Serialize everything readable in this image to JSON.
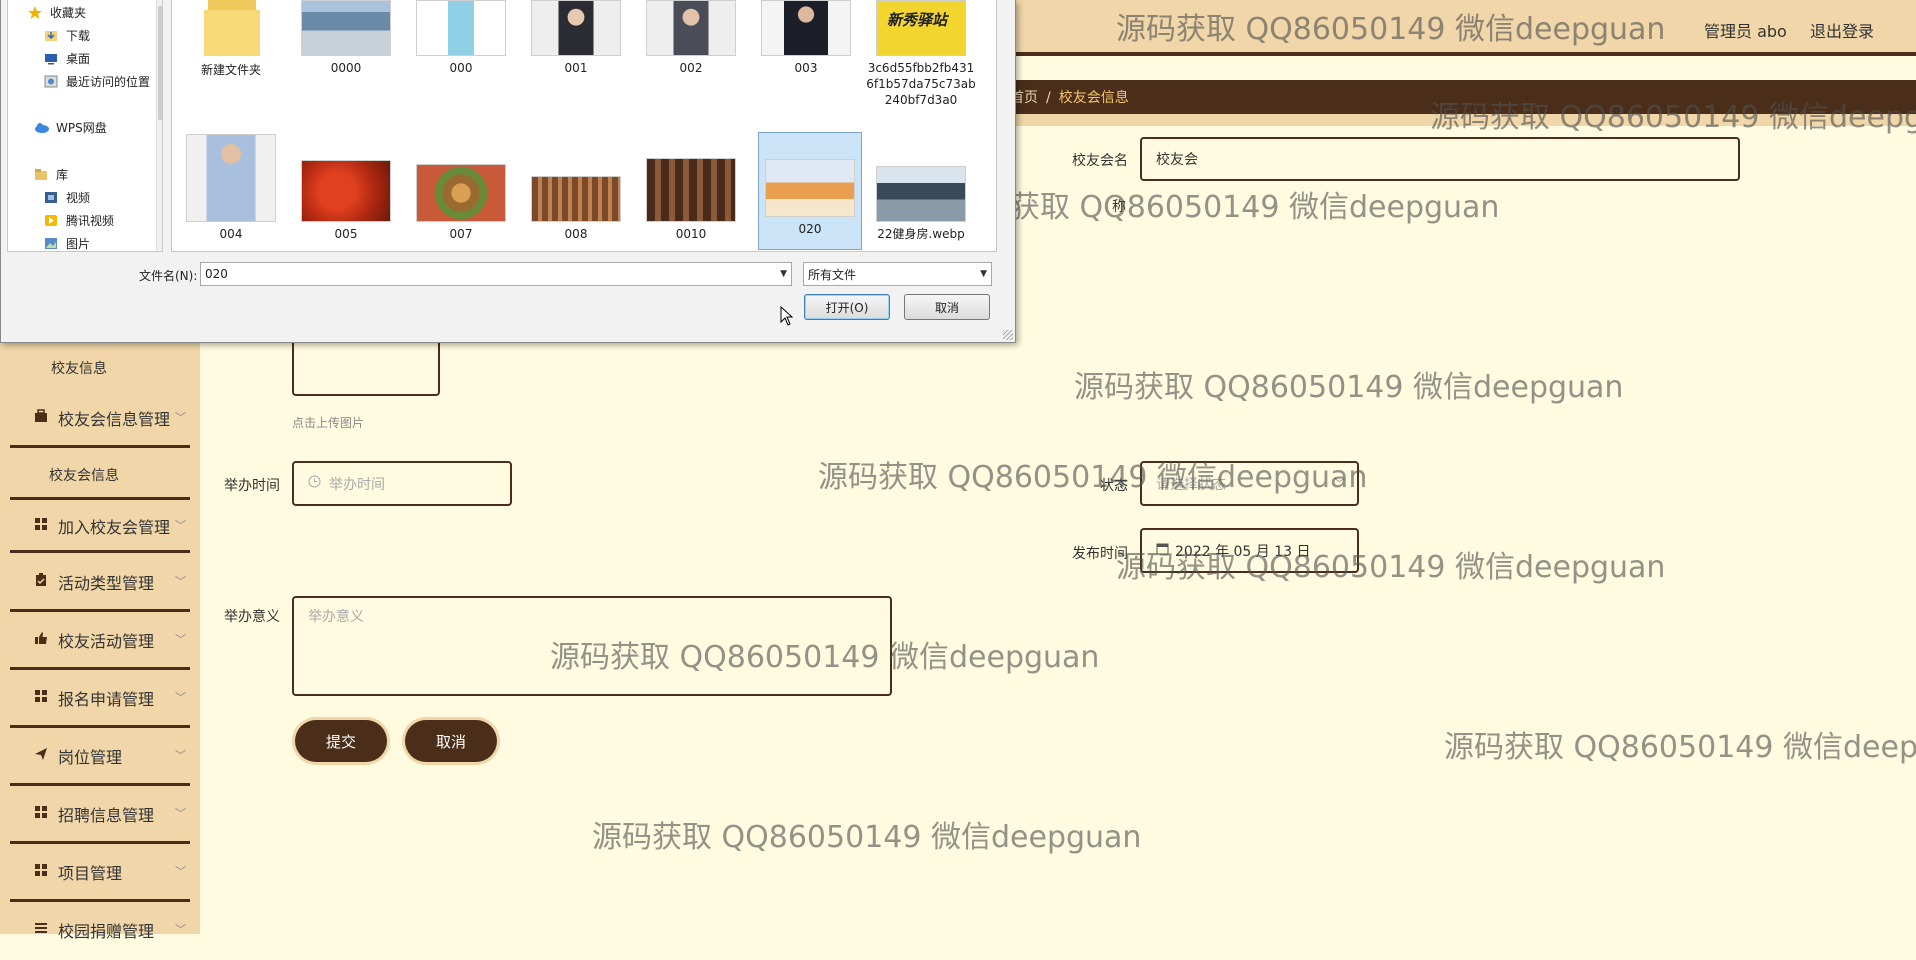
{
  "header": {
    "user": "管理员 abo",
    "logout": "退出登录"
  },
  "breadcrumb": {
    "home": "首页",
    "current": "校友会信息"
  },
  "sidebar": {
    "top_sub": "校友信息",
    "items": [
      {
        "label": "校友会信息管理",
        "icon": "briefcase-icon"
      },
      {
        "label": "加入校友会管理",
        "icon": "grid-icon"
      },
      {
        "label": "活动类型管理",
        "icon": "clipboard-icon"
      },
      {
        "label": "校友活动管理",
        "icon": "thumb-icon"
      },
      {
        "label": "报名申请管理",
        "icon": "grid-icon"
      },
      {
        "label": "岗位管理",
        "icon": "send-icon"
      },
      {
        "label": "招聘信息管理",
        "icon": "grid-icon"
      },
      {
        "label": "项目管理",
        "icon": "grid-icon"
      },
      {
        "label": "校园捐赠管理",
        "icon": "list-icon"
      }
    ],
    "sub_item": "校友会信息"
  },
  "form": {
    "name_label": "校友会名",
    "name_value": "校友会",
    "name_label_fragment": "称",
    "upload_hint": "点击上传图片",
    "time_label": "举办时间",
    "time_placeholder": "举办时间",
    "status_label": "状态",
    "status_placeholder": "请选择状态",
    "publish_label": "发布时间",
    "publish_value": "2022 年 05 月 13 日",
    "meaning_label": "举办意义",
    "meaning_placeholder": "举办意义",
    "submit": "提交",
    "cancel": "取消"
  },
  "watermark": "源码获取 QQ86050149 微信deepguan",
  "dialog": {
    "nav": [
      {
        "label": "收藏夹",
        "icon": "star-icon"
      },
      {
        "label": "下载",
        "icon": "download-icon"
      },
      {
        "label": "桌面",
        "icon": "desktop-icon"
      },
      {
        "label": "最近访问的位置",
        "icon": "recent-icon"
      },
      {
        "label": "WPS网盘",
        "icon": "cloud-icon"
      },
      {
        "label": "库",
        "icon": "library-icon"
      },
      {
        "label": "视频",
        "icon": "video-icon"
      },
      {
        "label": "腾讯视频",
        "icon": "tencent-video-icon"
      },
      {
        "label": "图片",
        "icon": "picture-icon"
      }
    ],
    "files": [
      {
        "name": "新建文件夹",
        "thumb": "folder"
      },
      {
        "name": "0000",
        "thumb": "bus"
      },
      {
        "name": "000",
        "thumb": "bottle"
      },
      {
        "name": "001",
        "thumb": "person-f"
      },
      {
        "name": "002",
        "thumb": "person-f2"
      },
      {
        "name": "003",
        "thumb": "suit"
      },
      {
        "name": "3c6d55fbb2fb4316f1b57da75c73ab240bf7d3a0",
        "thumb": "poster"
      },
      {
        "name": "004",
        "thumb": "man"
      },
      {
        "name": "005",
        "thumb": "food-red"
      },
      {
        "name": "007",
        "thumb": "food-mix"
      },
      {
        "name": "008",
        "thumb": "bbq"
      },
      {
        "name": "0010",
        "thumb": "shelves"
      },
      {
        "name": "020",
        "thumb": "room",
        "selected": true
      },
      {
        "name": "22健身房.webp",
        "thumb": "gym"
      }
    ],
    "poster_text": "新秀驿站",
    "filename_label": "文件名(N):",
    "filename_value": "020",
    "filetype_value": "所有文件",
    "open": "打开(O)",
    "cancel": "取消"
  }
}
